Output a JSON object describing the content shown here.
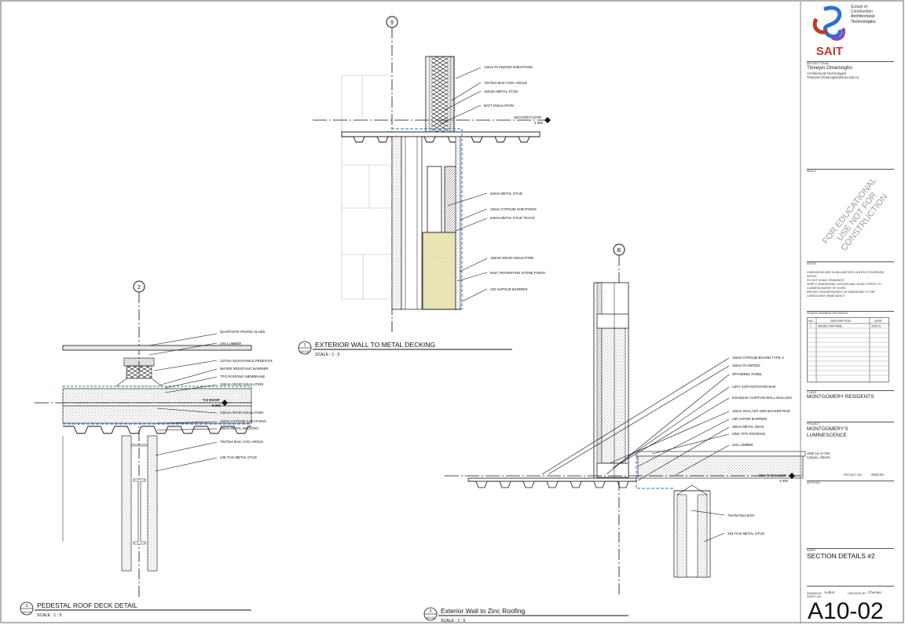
{
  "detail_wall": {
    "grid": "9",
    "number": "1",
    "sheet_ref": "A10-02",
    "title": "EXTERIOR WALL TO METAL DECKING",
    "scale": "SCALE : 1 : 5",
    "level": "SECOND FLOOR",
    "level_elev": "4 000",
    "notes": [
      "13mm PLYWOOD SHEATHING",
      "76x76x4.8mm CISC ANGLE",
      "152mm METAL STUD",
      "BATT INSULATION",
      "64mm METAL STUD",
      "16mm GYPSUM SHEATHING",
      "64mm METAL STUD TRACK",
      "152mm RIGID INSULATION",
      "8mm TRAVERTINE STONE FINISH",
      "AIR VAPOUR BARRIER"
    ]
  },
  "detail_roof": {
    "grid": "2",
    "number": "3",
    "sheet_ref": "A10-02",
    "title": "PEDESTAL ROOF DECK DETAIL",
    "scale": "SCALE : 1 : 5",
    "level": "T.O ROOF",
    "level_elev": "8 000",
    "notes": [
      "QUARTZITE PAVING SLABS",
      "2X6 LUMBER",
      "127mm ADJUSTABLE PEDESTAL",
      "WATER RESISTANT BARRIER",
      "TPO ROOFING MEMBRANE",
      "150mm RIGID INSULATION",
      "150mm RIGID INSULATION",
      "16mm GYPSUM SHEATHING",
      "38mm METAL DECKING",
      "76x76x4.8mm CISC ANGLE",
      "135.7mm METAL STUD"
    ]
  },
  "detail_zinc": {
    "grid": "B",
    "number": "2",
    "sheet_ref": "A10-02",
    "title": "Exterior Wall to Zinc Roofing",
    "scale": "SCALE : 1 : 5",
    "level": "SECOND FLOOR",
    "level_elev": "4 000",
    "notes": [
      "16mm GYPSUM BOARD TYPE X",
      "16mm PLYWOOD",
      "SPANDREL PANEL",
      "LEFT ANTI-ROTATION BAR",
      "64x181mm CURTAIN WALL MULLION",
      "10mm SEALANT AND BACKER ROD",
      "AIR VAPOR BARRIER",
      "38mm METAL DECK",
      "ZINC TPO ROOFING",
      "2x6 LUMBER",
      "76x76x76x4.8mm",
      "153.7mm METAL STUD"
    ]
  },
  "title_block": {
    "logo_word": "SAIT",
    "school_lines": [
      "School of",
      "Construction"
    ],
    "program_lines": [
      "Architectural",
      "Technologies"
    ],
    "team_label": "PROJECT TEAM",
    "team_name": "Timieyin Omamogho",
    "team_role": "Architectural Technologist",
    "team_email": "Timieyin.Omamogho@edu.sait.ca",
    "seals_label": "SEALS",
    "stamp": "FOR EDUCATIONAL USE NOT FOR CONSTRUCTION",
    "notes_label": "NOTES",
    "notes": [
      "DIMENSIONS ARE IN MILLIMETERS UNLESS OTHERWISE NOTED.",
      "DO NOT SCALE DRAWINGS.",
      "VERIFY DIMENSIONS, DATUMS AND LEVELS PRIOR TO COMMENCEMENT OF WORK.",
      "REPORT DISCREPANCIES OR OMISSIONS TO THE CONSULTANT IMMEDIATELY."
    ],
    "issued_label": "ISSUED DRAWING PACKAGES",
    "issued_headers": [
      "NO.",
      "DESCRIPTION",
      "DATE"
    ],
    "issued_rows": [
      [
        "1",
        "ISSUED FOR FINAL",
        "2023-01"
      ]
    ],
    "client_label": "CLIENT",
    "client": "MONTGOMERY RESIDENTS",
    "project_label": "PROJECT",
    "project_lines": [
      "MONTGOMERY'S",
      "LUMINESCENCE"
    ],
    "address_lines": [
      "4608 16 AV NW",
      "Calgary, Alberta"
    ],
    "project_no_label": "PROJECT NO:",
    "project_no": "2023.03",
    "keyplan_label": "KEYPLAN",
    "sheet_label": "SHEET",
    "sheet_title": "SECTION DETAILS #2",
    "drawn_label": "DRAWN BY",
    "drawn_by": "Author",
    "checked_label": "CHECKED BY",
    "checked_by": "Checker",
    "sheetno_label": "SHEET NO.",
    "sheet_no": "A10-02"
  }
}
